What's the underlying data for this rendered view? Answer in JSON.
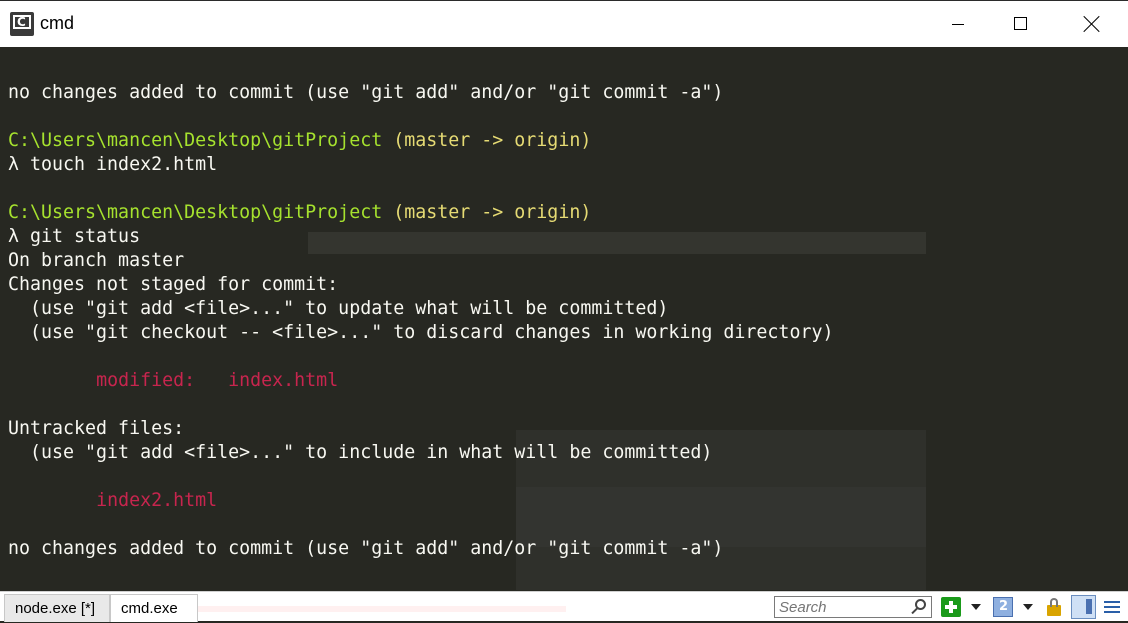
{
  "window": {
    "title": "cmd"
  },
  "console_lines": [
    [
      {
        "t": "",
        "c": ""
      }
    ],
    [
      {
        "t": "no changes added to commit (use \"git add\" and/or \"git commit -a\")",
        "c": ""
      }
    ],
    [
      {
        "t": "",
        "c": ""
      }
    ],
    [
      {
        "t": "C:\\Users\\mancen\\Desktop\\gitProject",
        "c": "path"
      },
      {
        "t": " (master -> origin)",
        "c": "branch"
      }
    ],
    [
      {
        "t": "λ touch index2.html",
        "c": ""
      }
    ],
    [
      {
        "t": "",
        "c": ""
      }
    ],
    [
      {
        "t": "C:\\Users\\mancen\\Desktop\\gitProject",
        "c": "path"
      },
      {
        "t": " (master -> origin)",
        "c": "branch"
      }
    ],
    [
      {
        "t": "λ git status",
        "c": ""
      }
    ],
    [
      {
        "t": "On branch master",
        "c": ""
      }
    ],
    [
      {
        "t": "Changes not staged for commit:",
        "c": ""
      }
    ],
    [
      {
        "t": "  (use \"git add <file>...\" to update what will be committed)",
        "c": ""
      }
    ],
    [
      {
        "t": "  (use \"git checkout -- <file>...\" to discard changes in working directory)",
        "c": ""
      }
    ],
    [
      {
        "t": "",
        "c": ""
      }
    ],
    [
      {
        "t": "        ",
        "c": ""
      },
      {
        "t": "modified:   index.html",
        "c": "red"
      }
    ],
    [
      {
        "t": "",
        "c": ""
      }
    ],
    [
      {
        "t": "Untracked files:",
        "c": ""
      }
    ],
    [
      {
        "t": "  (use \"git add <file>...\" to include in what will be committed)",
        "c": ""
      }
    ],
    [
      {
        "t": "",
        "c": ""
      }
    ],
    [
      {
        "t": "        ",
        "c": ""
      },
      {
        "t": "index2.html",
        "c": "red"
      }
    ],
    [
      {
        "t": "",
        "c": ""
      }
    ],
    [
      {
        "t": "no changes added to commit (use \"git add\" and/or \"git commit -a\")",
        "c": ""
      }
    ]
  ],
  "tabs": [
    {
      "label": "node.exe [*]"
    },
    {
      "label": "cmd.exe"
    }
  ],
  "search": {
    "placeholder": "Search"
  },
  "toolbar_icons": [
    "plus-icon",
    "chevron-down-icon",
    "layout-icon",
    "chevron-down-icon",
    "lock-icon",
    "panel-icon",
    "menu-icon"
  ],
  "colors": {
    "background": "#272822",
    "text": "#f8f8f2",
    "path": "#a6e22e",
    "branch": "#e6db74",
    "modified": "#c7254e"
  }
}
